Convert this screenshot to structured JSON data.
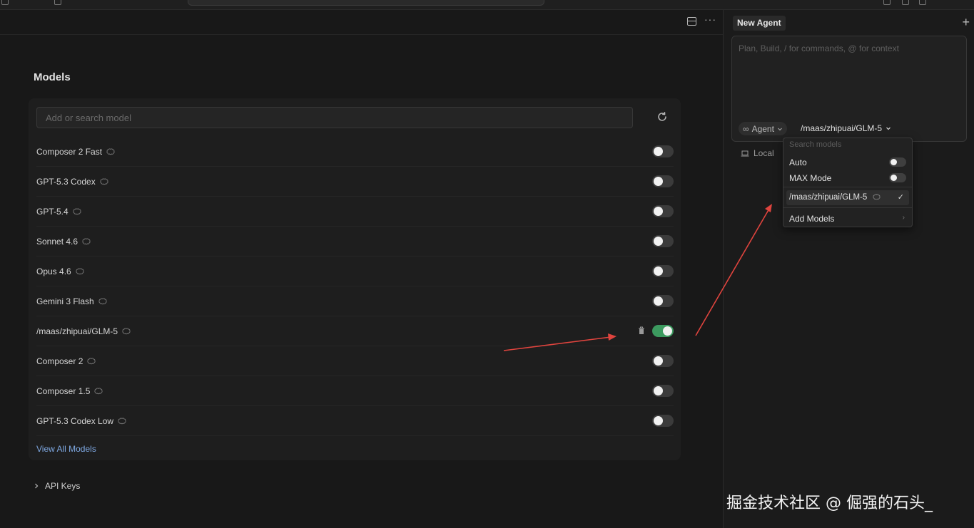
{
  "settings": {
    "section_title": "Models",
    "search_placeholder": "Add or search model",
    "models": [
      {
        "name": "Composer 2 Fast",
        "enabled": false
      },
      {
        "name": "GPT-5.3 Codex",
        "enabled": false
      },
      {
        "name": "GPT-5.4",
        "enabled": false
      },
      {
        "name": "Sonnet 4.6",
        "enabled": false
      },
      {
        "name": "Opus 4.6",
        "enabled": false
      },
      {
        "name": "Gemini 3 Flash",
        "enabled": false
      },
      {
        "name": "/maas/zhipuai/GLM-5",
        "enabled": true,
        "deletable": true
      },
      {
        "name": "Composer 2",
        "enabled": false
      },
      {
        "name": "Composer 1.5",
        "enabled": false
      },
      {
        "name": "GPT-5.3 Codex Low",
        "enabled": false
      }
    ],
    "view_all_label": "View All Models",
    "api_keys_label": "API Keys"
  },
  "agent_panel": {
    "tab_label": "New Agent",
    "composer_placeholder": "Plan, Build, / for commands, @ for context",
    "mode_label": "Agent",
    "selected_model": "/maas/zhipuai/GLM-5",
    "local_label": "Local",
    "dropdown": {
      "search_placeholder": "Search models",
      "auto_label": "Auto",
      "auto_enabled": false,
      "max_mode_label": "MAX Mode",
      "max_mode_enabled": false,
      "selected_item": "/maas/zhipuai/GLM-5",
      "add_models_label": "Add Models"
    }
  },
  "watermark": "掘金技术社区 @ 倔强的石头_",
  "colors": {
    "toggle_on": "#3c9a5f",
    "link": "#7fa9e3",
    "arrow": "#e0443e"
  }
}
